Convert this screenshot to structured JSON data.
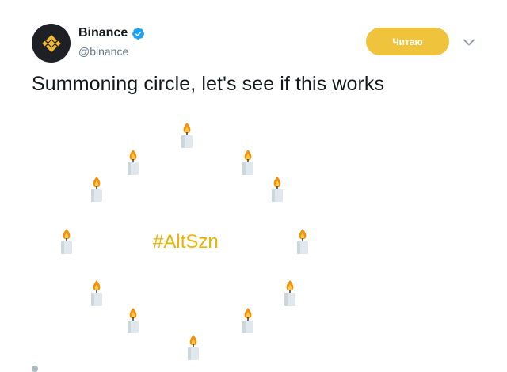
{
  "author": {
    "name": "Binance",
    "handle": "@binance",
    "verified": true,
    "avatar_icon": "binance-logo-icon",
    "avatar_color": "#1e2026",
    "logo_color": "#f3ba2f"
  },
  "follow_button": {
    "label": "Читаю",
    "color": "#f0c33c"
  },
  "menu": {
    "icon": "chevron-down-icon"
  },
  "tweet": {
    "text": "Summoning circle, let's see if this works",
    "hashtag": "#AltSzn",
    "hashtag_color": "#e8b600"
  },
  "media": {
    "candle_icon": "candle-icon",
    "candle_count": 12
  }
}
